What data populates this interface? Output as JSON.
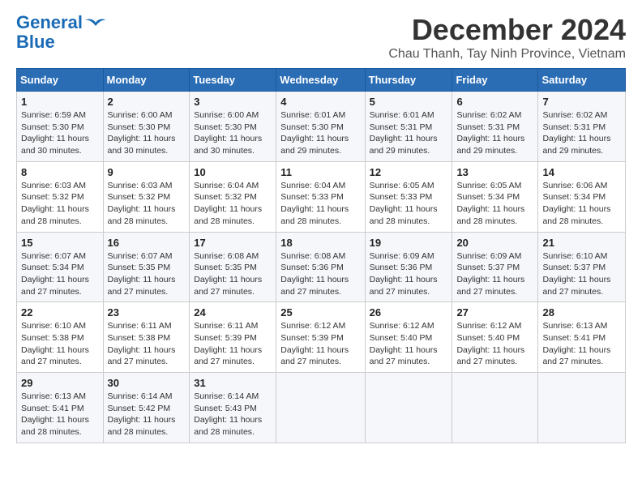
{
  "logo": {
    "line1": "General",
    "line2": "Blue"
  },
  "title": "December 2024",
  "location": "Chau Thanh, Tay Ninh Province, Vietnam",
  "header": {
    "days": [
      "Sunday",
      "Monday",
      "Tuesday",
      "Wednesday",
      "Thursday",
      "Friday",
      "Saturday"
    ]
  },
  "weeks": [
    [
      {
        "day": "1",
        "sunrise": "6:59 AM",
        "sunset": "5:30 PM",
        "daylight": "11 hours and 30 minutes."
      },
      {
        "day": "2",
        "sunrise": "6:00 AM",
        "sunset": "5:30 PM",
        "daylight": "11 hours and 30 minutes."
      },
      {
        "day": "3",
        "sunrise": "6:00 AM",
        "sunset": "5:30 PM",
        "daylight": "11 hours and 30 minutes."
      },
      {
        "day": "4",
        "sunrise": "6:01 AM",
        "sunset": "5:30 PM",
        "daylight": "11 hours and 29 minutes."
      },
      {
        "day": "5",
        "sunrise": "6:01 AM",
        "sunset": "5:31 PM",
        "daylight": "11 hours and 29 minutes."
      },
      {
        "day": "6",
        "sunrise": "6:02 AM",
        "sunset": "5:31 PM",
        "daylight": "11 hours and 29 minutes."
      },
      {
        "day": "7",
        "sunrise": "6:02 AM",
        "sunset": "5:31 PM",
        "daylight": "11 hours and 29 minutes."
      }
    ],
    [
      {
        "day": "8",
        "sunrise": "6:03 AM",
        "sunset": "5:32 PM",
        "daylight": "11 hours and 28 minutes."
      },
      {
        "day": "9",
        "sunrise": "6:03 AM",
        "sunset": "5:32 PM",
        "daylight": "11 hours and 28 minutes."
      },
      {
        "day": "10",
        "sunrise": "6:04 AM",
        "sunset": "5:32 PM",
        "daylight": "11 hours and 28 minutes."
      },
      {
        "day": "11",
        "sunrise": "6:04 AM",
        "sunset": "5:33 PM",
        "daylight": "11 hours and 28 minutes."
      },
      {
        "day": "12",
        "sunrise": "6:05 AM",
        "sunset": "5:33 PM",
        "daylight": "11 hours and 28 minutes."
      },
      {
        "day": "13",
        "sunrise": "6:05 AM",
        "sunset": "5:34 PM",
        "daylight": "11 hours and 28 minutes."
      },
      {
        "day": "14",
        "sunrise": "6:06 AM",
        "sunset": "5:34 PM",
        "daylight": "11 hours and 28 minutes."
      }
    ],
    [
      {
        "day": "15",
        "sunrise": "6:07 AM",
        "sunset": "5:34 PM",
        "daylight": "11 hours and 27 minutes."
      },
      {
        "day": "16",
        "sunrise": "6:07 AM",
        "sunset": "5:35 PM",
        "daylight": "11 hours and 27 minutes."
      },
      {
        "day": "17",
        "sunrise": "6:08 AM",
        "sunset": "5:35 PM",
        "daylight": "11 hours and 27 minutes."
      },
      {
        "day": "18",
        "sunrise": "6:08 AM",
        "sunset": "5:36 PM",
        "daylight": "11 hours and 27 minutes."
      },
      {
        "day": "19",
        "sunrise": "6:09 AM",
        "sunset": "5:36 PM",
        "daylight": "11 hours and 27 minutes."
      },
      {
        "day": "20",
        "sunrise": "6:09 AM",
        "sunset": "5:37 PM",
        "daylight": "11 hours and 27 minutes."
      },
      {
        "day": "21",
        "sunrise": "6:10 AM",
        "sunset": "5:37 PM",
        "daylight": "11 hours and 27 minutes."
      }
    ],
    [
      {
        "day": "22",
        "sunrise": "6:10 AM",
        "sunset": "5:38 PM",
        "daylight": "11 hours and 27 minutes."
      },
      {
        "day": "23",
        "sunrise": "6:11 AM",
        "sunset": "5:38 PM",
        "daylight": "11 hours and 27 minutes."
      },
      {
        "day": "24",
        "sunrise": "6:11 AM",
        "sunset": "5:39 PM",
        "daylight": "11 hours and 27 minutes."
      },
      {
        "day": "25",
        "sunrise": "6:12 AM",
        "sunset": "5:39 PM",
        "daylight": "11 hours and 27 minutes."
      },
      {
        "day": "26",
        "sunrise": "6:12 AM",
        "sunset": "5:40 PM",
        "daylight": "11 hours and 27 minutes."
      },
      {
        "day": "27",
        "sunrise": "6:12 AM",
        "sunset": "5:40 PM",
        "daylight": "11 hours and 27 minutes."
      },
      {
        "day": "28",
        "sunrise": "6:13 AM",
        "sunset": "5:41 PM",
        "daylight": "11 hours and 27 minutes."
      }
    ],
    [
      {
        "day": "29",
        "sunrise": "6:13 AM",
        "sunset": "5:41 PM",
        "daylight": "11 hours and 28 minutes."
      },
      {
        "day": "30",
        "sunrise": "6:14 AM",
        "sunset": "5:42 PM",
        "daylight": "11 hours and 28 minutes."
      },
      {
        "day": "31",
        "sunrise": "6:14 AM",
        "sunset": "5:43 PM",
        "daylight": "11 hours and 28 minutes."
      },
      null,
      null,
      null,
      null
    ]
  ]
}
